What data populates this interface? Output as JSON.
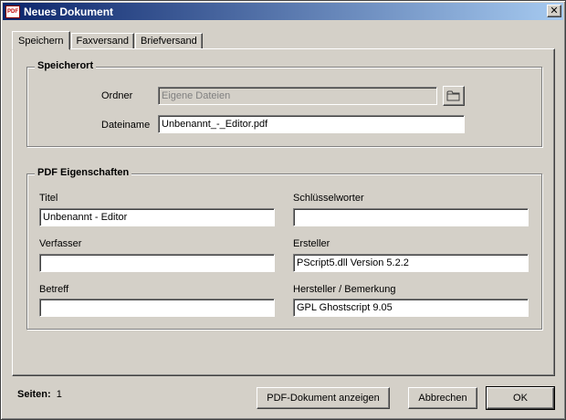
{
  "window": {
    "title": "Neues Dokument",
    "close_glyph": "✕",
    "app_icon_text": "PDF"
  },
  "tabs": [
    {
      "label": "Speichern",
      "active": true
    },
    {
      "label": "Faxversand",
      "active": false
    },
    {
      "label": "Briefversand",
      "active": false
    }
  ],
  "speicherort": {
    "title": "Speicherort",
    "ordner_label": "Ordner",
    "ordner_value": "Eigene Dateien",
    "browse_icon": "folder-icon",
    "dateiname_label": "Dateiname",
    "dateiname_value": "Unbenannt_-_Editor.pdf"
  },
  "pdf": {
    "title": "PDF Eigenschaften",
    "titel_label": "Titel",
    "titel_value": "Unbenannt - Editor",
    "schluessel_label": "Schlüsselworter",
    "schluessel_value": "",
    "verfasser_label": "Verfasser",
    "verfasser_value": "",
    "ersteller_label": "Ersteller",
    "ersteller_value": "PScript5.dll Version 5.2.2",
    "betreff_label": "Betreff",
    "betreff_value": "",
    "hersteller_label": "Hersteller / Bemerkung",
    "hersteller_value": "GPL Ghostscript 9.05"
  },
  "footer": {
    "seiten_label": "Seiten:",
    "seiten_value": "1",
    "show_button": "PDF-Dokument anzeigen",
    "cancel_button": "Abbrechen",
    "ok_button": "OK"
  }
}
